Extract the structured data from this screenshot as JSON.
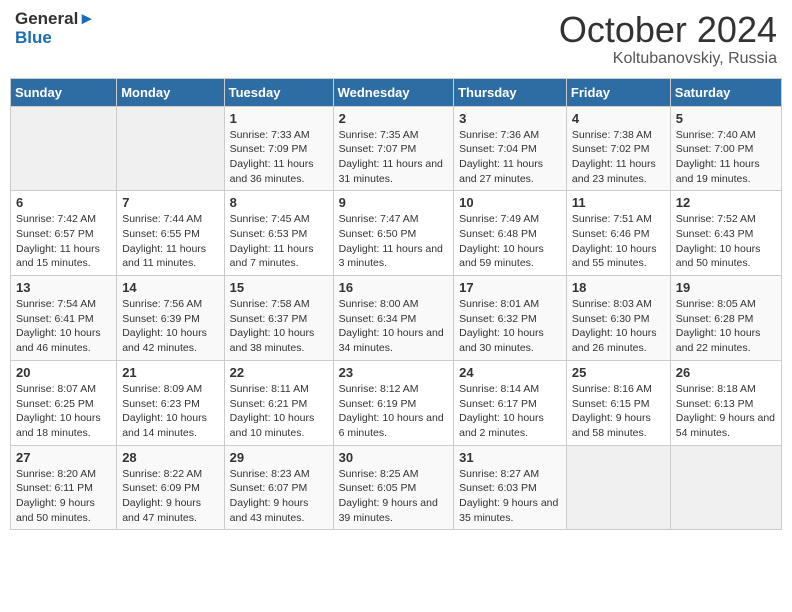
{
  "logo": {
    "line1": "General",
    "line2": "Blue"
  },
  "title": "October 2024",
  "location": "Koltubanovskiy, Russia",
  "weekdays": [
    "Sunday",
    "Monday",
    "Tuesday",
    "Wednesday",
    "Thursday",
    "Friday",
    "Saturday"
  ],
  "weeks": [
    [
      {
        "day": "",
        "sunrise": "",
        "sunset": "",
        "daylight": ""
      },
      {
        "day": "",
        "sunrise": "",
        "sunset": "",
        "daylight": ""
      },
      {
        "day": "1",
        "sunrise": "Sunrise: 7:33 AM",
        "sunset": "Sunset: 7:09 PM",
        "daylight": "Daylight: 11 hours and 36 minutes."
      },
      {
        "day": "2",
        "sunrise": "Sunrise: 7:35 AM",
        "sunset": "Sunset: 7:07 PM",
        "daylight": "Daylight: 11 hours and 31 minutes."
      },
      {
        "day": "3",
        "sunrise": "Sunrise: 7:36 AM",
        "sunset": "Sunset: 7:04 PM",
        "daylight": "Daylight: 11 hours and 27 minutes."
      },
      {
        "day": "4",
        "sunrise": "Sunrise: 7:38 AM",
        "sunset": "Sunset: 7:02 PM",
        "daylight": "Daylight: 11 hours and 23 minutes."
      },
      {
        "day": "5",
        "sunrise": "Sunrise: 7:40 AM",
        "sunset": "Sunset: 7:00 PM",
        "daylight": "Daylight: 11 hours and 19 minutes."
      }
    ],
    [
      {
        "day": "6",
        "sunrise": "Sunrise: 7:42 AM",
        "sunset": "Sunset: 6:57 PM",
        "daylight": "Daylight: 11 hours and 15 minutes."
      },
      {
        "day": "7",
        "sunrise": "Sunrise: 7:44 AM",
        "sunset": "Sunset: 6:55 PM",
        "daylight": "Daylight: 11 hours and 11 minutes."
      },
      {
        "day": "8",
        "sunrise": "Sunrise: 7:45 AM",
        "sunset": "Sunset: 6:53 PM",
        "daylight": "Daylight: 11 hours and 7 minutes."
      },
      {
        "day": "9",
        "sunrise": "Sunrise: 7:47 AM",
        "sunset": "Sunset: 6:50 PM",
        "daylight": "Daylight: 11 hours and 3 minutes."
      },
      {
        "day": "10",
        "sunrise": "Sunrise: 7:49 AM",
        "sunset": "Sunset: 6:48 PM",
        "daylight": "Daylight: 10 hours and 59 minutes."
      },
      {
        "day": "11",
        "sunrise": "Sunrise: 7:51 AM",
        "sunset": "Sunset: 6:46 PM",
        "daylight": "Daylight: 10 hours and 55 minutes."
      },
      {
        "day": "12",
        "sunrise": "Sunrise: 7:52 AM",
        "sunset": "Sunset: 6:43 PM",
        "daylight": "Daylight: 10 hours and 50 minutes."
      }
    ],
    [
      {
        "day": "13",
        "sunrise": "Sunrise: 7:54 AM",
        "sunset": "Sunset: 6:41 PM",
        "daylight": "Daylight: 10 hours and 46 minutes."
      },
      {
        "day": "14",
        "sunrise": "Sunrise: 7:56 AM",
        "sunset": "Sunset: 6:39 PM",
        "daylight": "Daylight: 10 hours and 42 minutes."
      },
      {
        "day": "15",
        "sunrise": "Sunrise: 7:58 AM",
        "sunset": "Sunset: 6:37 PM",
        "daylight": "Daylight: 10 hours and 38 minutes."
      },
      {
        "day": "16",
        "sunrise": "Sunrise: 8:00 AM",
        "sunset": "Sunset: 6:34 PM",
        "daylight": "Daylight: 10 hours and 34 minutes."
      },
      {
        "day": "17",
        "sunrise": "Sunrise: 8:01 AM",
        "sunset": "Sunset: 6:32 PM",
        "daylight": "Daylight: 10 hours and 30 minutes."
      },
      {
        "day": "18",
        "sunrise": "Sunrise: 8:03 AM",
        "sunset": "Sunset: 6:30 PM",
        "daylight": "Daylight: 10 hours and 26 minutes."
      },
      {
        "day": "19",
        "sunrise": "Sunrise: 8:05 AM",
        "sunset": "Sunset: 6:28 PM",
        "daylight": "Daylight: 10 hours and 22 minutes."
      }
    ],
    [
      {
        "day": "20",
        "sunrise": "Sunrise: 8:07 AM",
        "sunset": "Sunset: 6:25 PM",
        "daylight": "Daylight: 10 hours and 18 minutes."
      },
      {
        "day": "21",
        "sunrise": "Sunrise: 8:09 AM",
        "sunset": "Sunset: 6:23 PM",
        "daylight": "Daylight: 10 hours and 14 minutes."
      },
      {
        "day": "22",
        "sunrise": "Sunrise: 8:11 AM",
        "sunset": "Sunset: 6:21 PM",
        "daylight": "Daylight: 10 hours and 10 minutes."
      },
      {
        "day": "23",
        "sunrise": "Sunrise: 8:12 AM",
        "sunset": "Sunset: 6:19 PM",
        "daylight": "Daylight: 10 hours and 6 minutes."
      },
      {
        "day": "24",
        "sunrise": "Sunrise: 8:14 AM",
        "sunset": "Sunset: 6:17 PM",
        "daylight": "Daylight: 10 hours and 2 minutes."
      },
      {
        "day": "25",
        "sunrise": "Sunrise: 8:16 AM",
        "sunset": "Sunset: 6:15 PM",
        "daylight": "Daylight: 9 hours and 58 minutes."
      },
      {
        "day": "26",
        "sunrise": "Sunrise: 8:18 AM",
        "sunset": "Sunset: 6:13 PM",
        "daylight": "Daylight: 9 hours and 54 minutes."
      }
    ],
    [
      {
        "day": "27",
        "sunrise": "Sunrise: 8:20 AM",
        "sunset": "Sunset: 6:11 PM",
        "daylight": "Daylight: 9 hours and 50 minutes."
      },
      {
        "day": "28",
        "sunrise": "Sunrise: 8:22 AM",
        "sunset": "Sunset: 6:09 PM",
        "daylight": "Daylight: 9 hours and 47 minutes."
      },
      {
        "day": "29",
        "sunrise": "Sunrise: 8:23 AM",
        "sunset": "Sunset: 6:07 PM",
        "daylight": "Daylight: 9 hours and 43 minutes."
      },
      {
        "day": "30",
        "sunrise": "Sunrise: 8:25 AM",
        "sunset": "Sunset: 6:05 PM",
        "daylight": "Daylight: 9 hours and 39 minutes."
      },
      {
        "day": "31",
        "sunrise": "Sunrise: 8:27 AM",
        "sunset": "Sunset: 6:03 PM",
        "daylight": "Daylight: 9 hours and 35 minutes."
      },
      {
        "day": "",
        "sunrise": "",
        "sunset": "",
        "daylight": ""
      },
      {
        "day": "",
        "sunrise": "",
        "sunset": "",
        "daylight": ""
      }
    ]
  ]
}
